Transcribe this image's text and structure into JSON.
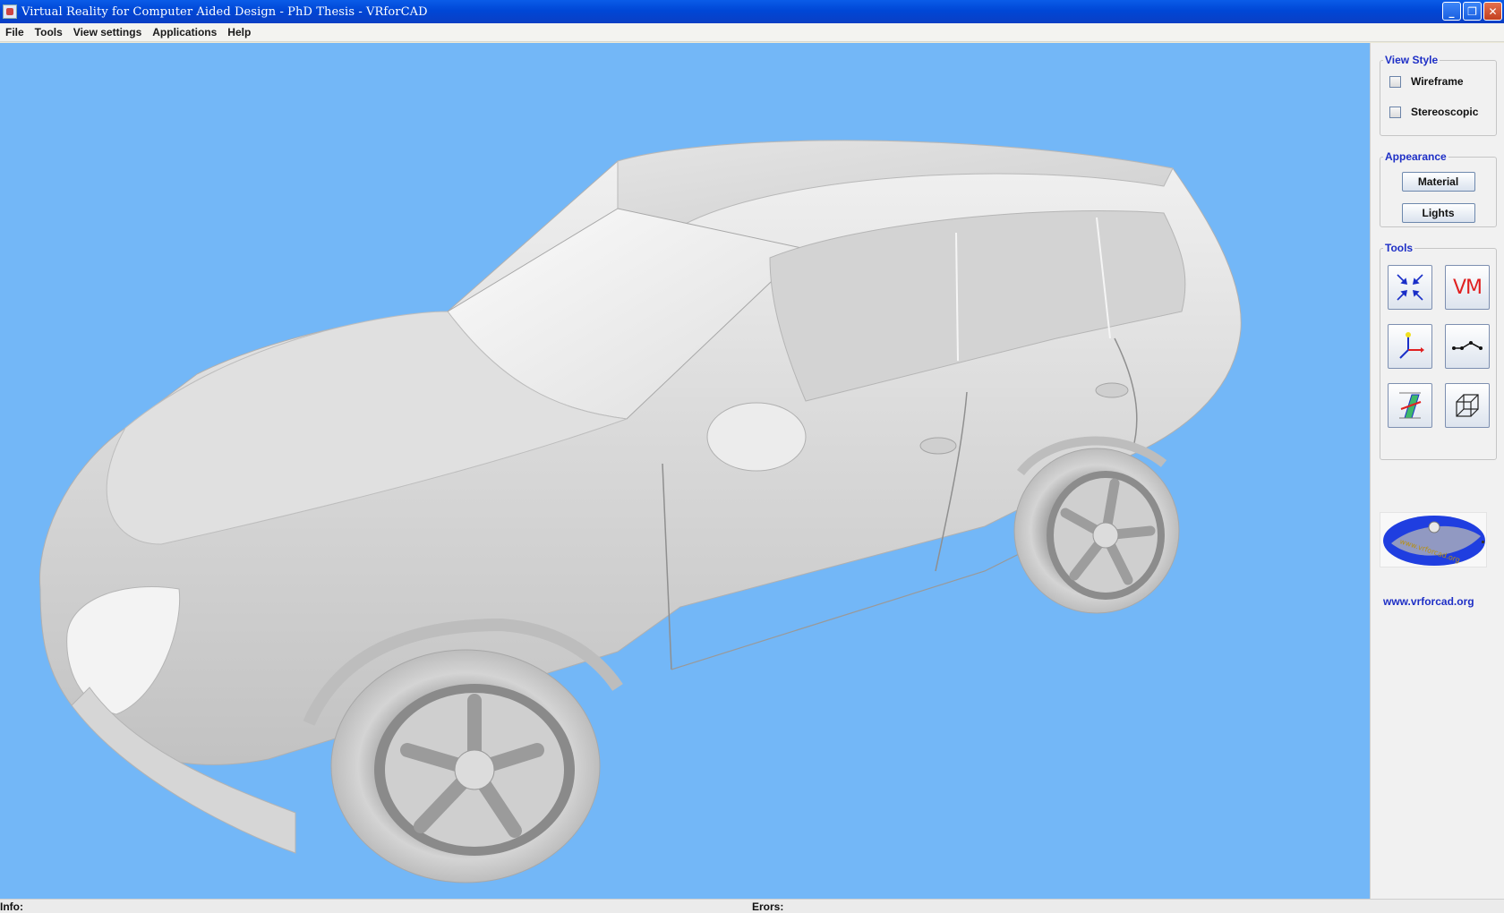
{
  "window": {
    "title": "Virtual Reality for Computer Aided Design - PhD Thesis  - VRforCAD",
    "controls": [
      "minimize-icon",
      "restore-icon",
      "close-icon"
    ]
  },
  "menu": {
    "items": [
      "File",
      "Tools",
      "View settings",
      "Applications",
      "Help"
    ]
  },
  "viewport": {
    "background_color": "#73b7f7",
    "model": "car-model"
  },
  "sidepanel": {
    "view_style": {
      "legend": "View Style",
      "checkboxes": [
        {
          "label": "Wireframe",
          "checked": false
        },
        {
          "label": "Stereoscopic",
          "checked": false
        }
      ]
    },
    "appearance": {
      "legend": "Appearance",
      "buttons": [
        "Material",
        "Lights"
      ]
    },
    "tools": {
      "legend": "Tools",
      "icons": [
        "fit-view-icon",
        "vm-icon",
        "axes-icon",
        "measure-line-icon",
        "section-plane-icon",
        "bounding-box-icon"
      ],
      "vm_text": "VM"
    },
    "logo": {
      "text": "www.vrforcad.org"
    },
    "site_link": "www.vrforcad.org"
  },
  "statusbar": {
    "info_label": "Info:",
    "errors_label": "Erors:"
  },
  "colors": {
    "title_bar": "#0a5ce8",
    "legend_text": "#1e2fc6",
    "viewport_bg": "#73b7f7"
  }
}
